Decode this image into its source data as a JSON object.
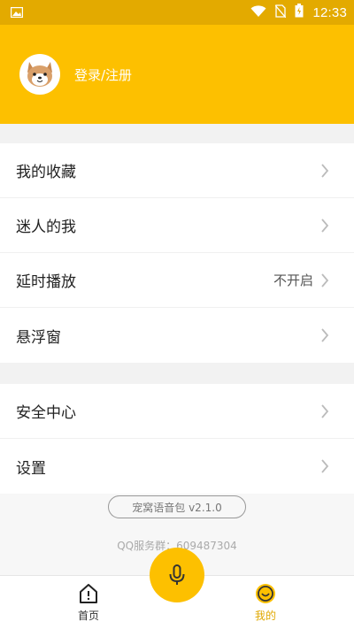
{
  "status_bar": {
    "time": "12:33",
    "icons": [
      "image-icon",
      "wifi-icon",
      "no-sim-icon",
      "battery-icon"
    ]
  },
  "header": {
    "login_label": "登录/注册",
    "avatar": "shiba-avatar-icon"
  },
  "menu_group_1": [
    {
      "label": "我的收藏",
      "value": ""
    },
    {
      "label": "迷人的我",
      "value": ""
    },
    {
      "label": "延时播放",
      "value": "不开启"
    },
    {
      "label": "悬浮窗",
      "value": ""
    }
  ],
  "menu_group_2": [
    {
      "label": "安全中心",
      "value": ""
    },
    {
      "label": "设置",
      "value": ""
    }
  ],
  "footer": {
    "version": "宠窝语音包 v2.1.0",
    "qq_group": "QQ服务群：609487304"
  },
  "tabbar": {
    "home_label": "首页",
    "mine_label": "我的",
    "active_tab": "我的"
  },
  "colors": {
    "accent": "#fdc000",
    "status_bar": "#e3aa00",
    "active_tab": "#e0a800"
  }
}
